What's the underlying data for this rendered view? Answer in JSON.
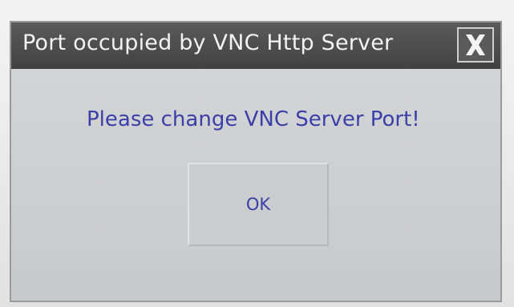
{
  "dialog": {
    "title": "Port occupied by VNC Http Server",
    "close_icon": "close-icon",
    "message": "Please change VNC Server Port!",
    "ok_label": "OK"
  },
  "colors": {
    "title_bar": "#4a4a4a",
    "title_text": "#f2f2f2",
    "body_background": "#cfd0d2",
    "message_text": "#3b3fa8"
  }
}
